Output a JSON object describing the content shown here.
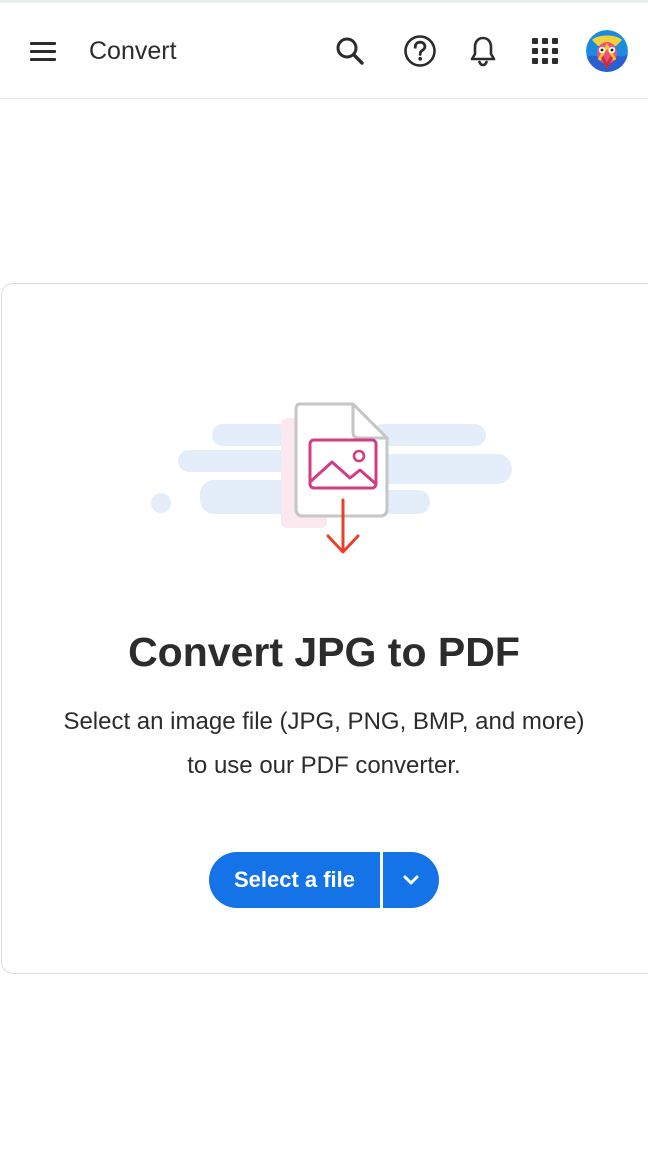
{
  "header": {
    "app_title": "Convert",
    "icons": [
      "menu-icon",
      "search-icon",
      "help-icon",
      "bell-icon",
      "apps-grid-icon",
      "avatar"
    ]
  },
  "card": {
    "illustration": "image-file-download-icon",
    "title": "Convert JPG to PDF",
    "description_line1": "Select an image file (JPG, PNG, BMP, and more)",
    "description_line2": "to use our PDF converter.",
    "select_button_label": "Select a file",
    "dropdown_icon": "chevron-down-icon"
  },
  "colors": {
    "accent": "#1473e6",
    "text": "#2c2c2c",
    "image_icon": "#d23c82",
    "arrow": "#e8402c",
    "cloud": "#e4edfa"
  }
}
